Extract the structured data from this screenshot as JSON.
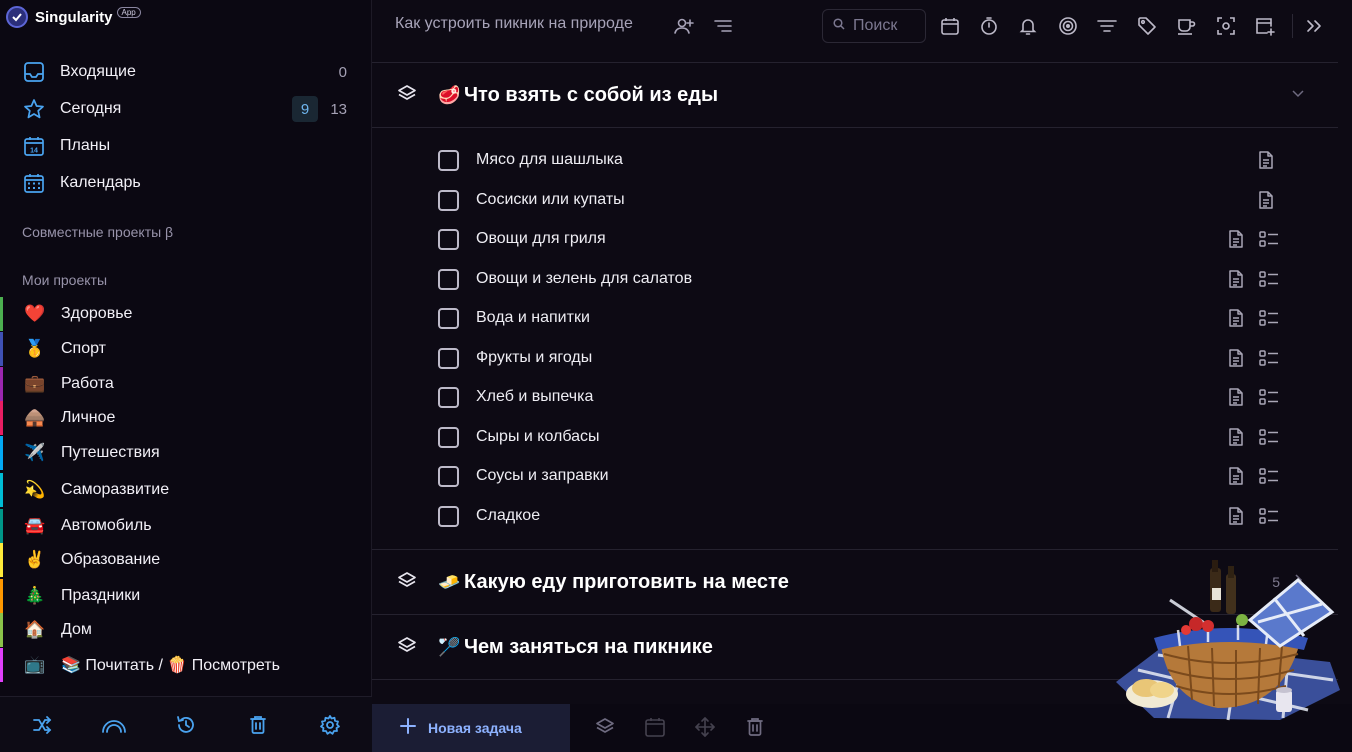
{
  "brand": {
    "name": "Singularity",
    "badge": "App"
  },
  "nav": [
    {
      "label": "Входящие",
      "icon": "inbox-icon",
      "count": "0"
    },
    {
      "label": "Сегодня",
      "icon": "star-icon",
      "count_highlight": "9",
      "count": "13"
    },
    {
      "label": "Планы",
      "icon": "calendar-14-icon"
    },
    {
      "label": "Календарь",
      "icon": "calendar-grid-icon"
    }
  ],
  "shared_projects_label": "Совместные проекты β",
  "my_projects_label": "Мои проекты",
  "projects": [
    {
      "emoji": "❤️",
      "label": "Здоровье",
      "color": "#4caf50"
    },
    {
      "emoji": "🥇",
      "label": "Спорт",
      "color": "#3f51b5"
    },
    {
      "emoji": "💼",
      "label": "Работа",
      "color": "#9c27b0"
    },
    {
      "emoji": "🛖",
      "label": "Личное",
      "color": "#e91e63"
    },
    {
      "emoji": "✈️",
      "label": "Путешествия",
      "color": "#03a9f4"
    },
    {
      "emoji": "💫",
      "label": "Саморазвитие",
      "color": "#00bcd4"
    },
    {
      "emoji": "🚘",
      "label": "Автомобиль",
      "color": "#009688"
    },
    {
      "emoji": "✌️",
      "label": "Образование",
      "color": "#ffeb3b"
    },
    {
      "emoji": "🎄",
      "label": "Праздники",
      "color": "#ff9800"
    },
    {
      "emoji": "🏠",
      "label": "Дом",
      "color": "#8bc34a"
    },
    {
      "emoji": "📺",
      "label": "📚 Почитать / 🍿 Посмотреть",
      "color": "#e040fb"
    }
  ],
  "footer_icons": [
    "shuffle-icon",
    "rainbow-icon",
    "history-icon",
    "trash-icon",
    "settings-icon"
  ],
  "header": {
    "title": "Как устроить пикник на природе",
    "search_placeholder": "Поиск"
  },
  "toolbar_icons": [
    "calendar-icon",
    "timer-icon",
    "bell-icon",
    "target-icon",
    "filter-icon",
    "tag-icon",
    "cup-icon",
    "focus-icon",
    "add-window-icon",
    "collapse-right-icon"
  ],
  "sections": [
    {
      "emoji": "🥩",
      "title": "Что взять с собой из еды",
      "expanded": true,
      "tasks": [
        {
          "label": "Мясо для шашлыка",
          "has_note": true,
          "has_subtasks": false
        },
        {
          "label": "Сосиски или купаты",
          "has_note": true,
          "has_subtasks": false
        },
        {
          "label": "Овощи для гриля",
          "has_note": true,
          "has_subtasks": true
        },
        {
          "label": "Овощи и зелень для салатов",
          "has_note": true,
          "has_subtasks": true
        },
        {
          "label": "Вода и напитки",
          "has_note": true,
          "has_subtasks": true
        },
        {
          "label": "Фрукты и ягоды",
          "has_note": true,
          "has_subtasks": true
        },
        {
          "label": "Хлеб и выпечка",
          "has_note": true,
          "has_subtasks": true
        },
        {
          "label": "Сыры и колбасы",
          "has_note": true,
          "has_subtasks": true
        },
        {
          "label": "Соусы и заправки",
          "has_note": true,
          "has_subtasks": true
        },
        {
          "label": "Сладкое",
          "has_note": true,
          "has_subtasks": true
        }
      ]
    },
    {
      "emoji": "🧈",
      "title": "Какую еду приготовить на месте",
      "count": "5",
      "expanded": false
    },
    {
      "emoji": "🏸",
      "title": "Чем заняться на пикнике",
      "expanded": false
    }
  ],
  "bottom": {
    "new_task_label": "Новая задача"
  },
  "accent": "#8db2ff"
}
